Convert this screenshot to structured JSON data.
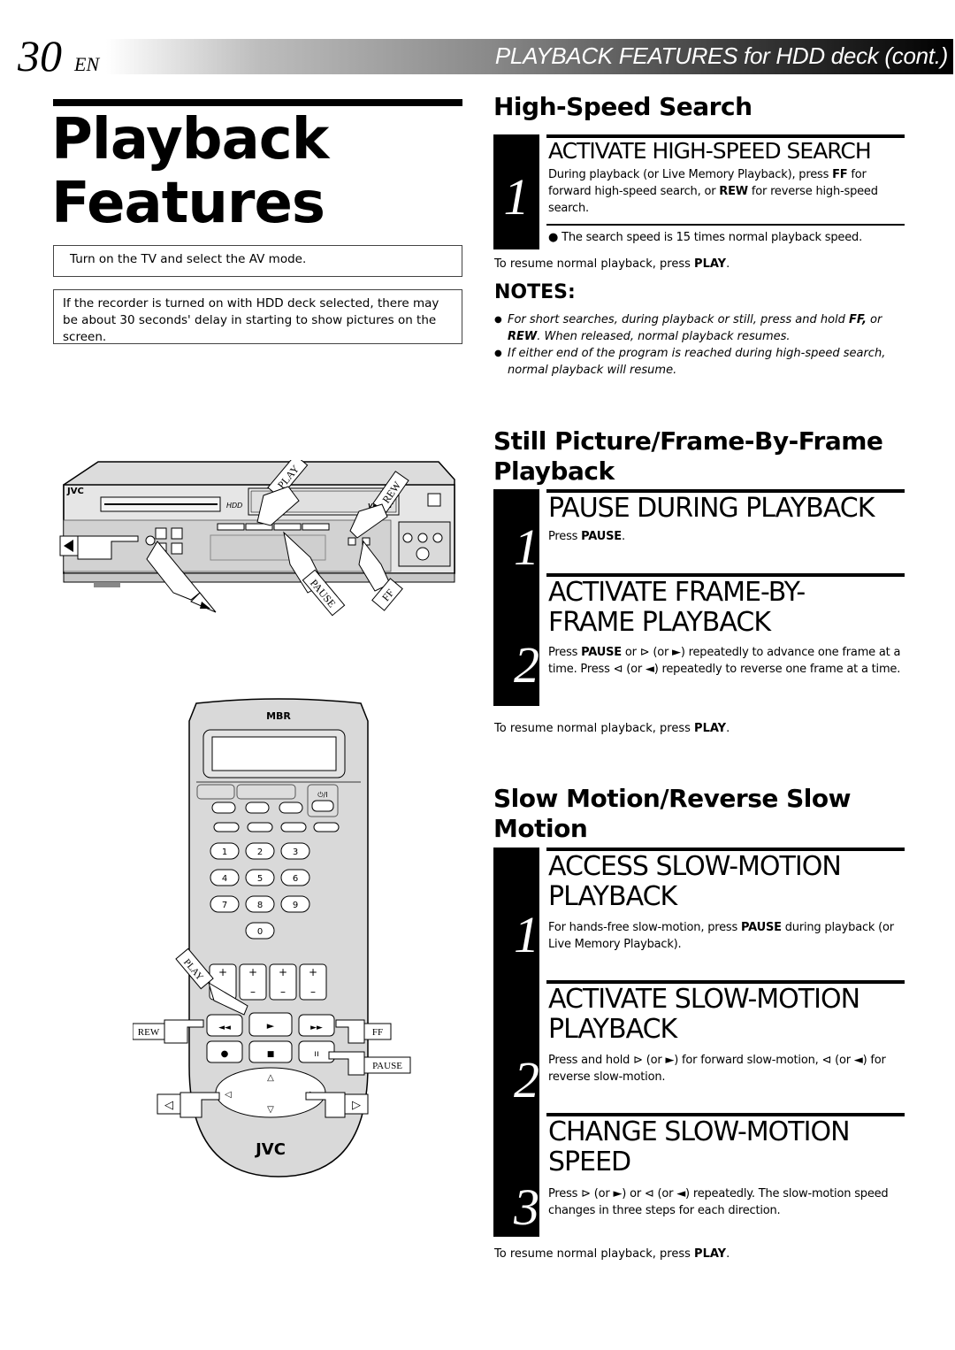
{
  "header": {
    "page_number": "30",
    "language": "EN",
    "section_title": "PLAYBACK FEATURES for HDD deck (cont.)"
  },
  "left": {
    "title_line1": "Playback",
    "title_line2": "Features",
    "box1": "Turn on the TV and select the AV mode.",
    "box2": "If the recorder is turned on with HDD deck selected, there may be about 30 seconds' delay in starting to show pictures on the screen.",
    "vcr_labels": {
      "play": "PLAY",
      "rew": "REW",
      "pause": "PAUSE",
      "ff": "FF",
      "brand": "JVC",
      "hdd": "HDD",
      "vhs": "VHS ET"
    },
    "remote_labels": {
      "brand_top": "MBR",
      "brand_bottom": "JVC",
      "play": "PLAY",
      "rew": "REW",
      "ff": "FF",
      "pause": "PAUSE",
      "power": "⏻/I",
      "keys": [
        "1",
        "2",
        "3",
        "4",
        "5",
        "6",
        "7",
        "8",
        "9",
        "0"
      ]
    }
  },
  "high_speed": {
    "title": "High-Speed Search",
    "step1": {
      "num": "1",
      "heading": "ACTIVATE HIGH-SPEED SEARCH",
      "body_a": "During playback (or Live Memory Playback), press ",
      "body_ff": "FF",
      "body_b": " for forward high-speed search, or ",
      "body_rew": "REW",
      "body_c": " for reverse high-speed search.",
      "bullet": "The search speed is 15 times normal playback speed."
    },
    "resume_a": "To resume normal playback, press ",
    "resume_b": "PLAY",
    "resume_c": "."
  },
  "notes": {
    "title": "NOTES:",
    "items": [
      {
        "a": "For short searches, during playback or still, press and hold ",
        "b1": "FF,",
        "c": " or ",
        "b2": "REW",
        "d": ". When released, normal playback resumes."
      },
      {
        "a": "If either end of the program is reached during high-speed search, normal playback will resume."
      }
    ]
  },
  "still": {
    "title_line1": "Still Picture/Frame-By-Frame",
    "title_line2": "Playback",
    "step1": {
      "num": "1",
      "heading": "PAUSE DURING PLAYBACK",
      "body_a": "Press ",
      "body_b": "PAUSE",
      "body_c": "."
    },
    "step2": {
      "num": "2",
      "heading_line1": "ACTIVATE FRAME-BY-",
      "heading_line2": "FRAME PLAYBACK",
      "body_a": "Press ",
      "body_b": "PAUSE",
      "body_c": " or ⊳ (or ►) repeatedly to advance one frame at a time. Press ⊲ (or ◄) repeatedly to reverse one frame at a time."
    },
    "resume_a": "To resume normal playback, press ",
    "resume_b": "PLAY",
    "resume_c": "."
  },
  "slow": {
    "title_line1": "Slow Motion/Reverse Slow",
    "title_line2": "Motion",
    "step1": {
      "num": "1",
      "heading_line1": "ACCESS SLOW-MOTION",
      "heading_line2": "PLAYBACK",
      "body_a": "For hands-free slow-motion, press ",
      "body_b": "PAUSE",
      "body_c": " during playback (or Live Memory Playback)."
    },
    "step2": {
      "num": "2",
      "heading_line1": "ACTIVATE SLOW-MOTION",
      "heading_line2": "PLAYBACK",
      "body": "Press and hold ⊳ (or ►) for forward slow-motion, ⊲ (or ◄) for reverse slow-motion."
    },
    "step3": {
      "num": "3",
      "heading_line1": "CHANGE SLOW-MOTION",
      "heading_line2": "SPEED",
      "body": "Press ⊳ (or ►) or ⊲ (or ◄) repeatedly. The slow-motion speed changes in three steps for each direction."
    },
    "resume_a": "To resume normal playback, press ",
    "resume_b": "PLAY",
    "resume_c": "."
  }
}
